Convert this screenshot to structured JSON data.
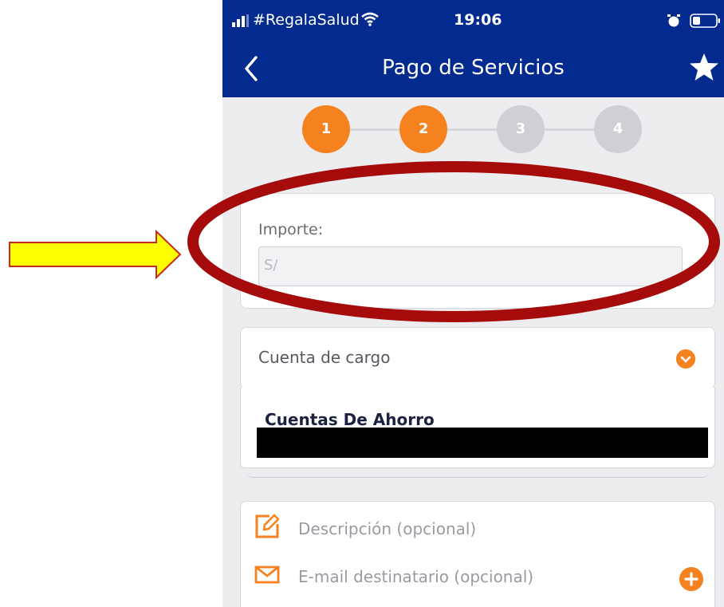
{
  "status_bar": {
    "carrier": "#RegalaSalud",
    "time": "19:06"
  },
  "header": {
    "title": "Pago de Servicios"
  },
  "stepper": {
    "steps": [
      "1",
      "2",
      "3",
      "4"
    ]
  },
  "importe": {
    "label": "Importe:",
    "placeholder": "S/"
  },
  "cuenta": {
    "label": "Cuenta de cargo",
    "option_title": "Cuentas De Ahorro"
  },
  "extras": {
    "description_placeholder": "Descripción (opcional)",
    "email_placeholder": "E-mail destinatario (opcional)"
  },
  "colors": {
    "header": "#022a8f",
    "accent": "#f5821f",
    "annotation_red": "#a50b0b",
    "arrow_yellow": "#ffff00"
  },
  "icons": [
    "signal-icon",
    "wifi-icon",
    "alarm-icon",
    "battery-icon",
    "back-icon",
    "star-icon",
    "chevron-down-icon",
    "edit-icon",
    "mail-icon",
    "plus-icon"
  ]
}
